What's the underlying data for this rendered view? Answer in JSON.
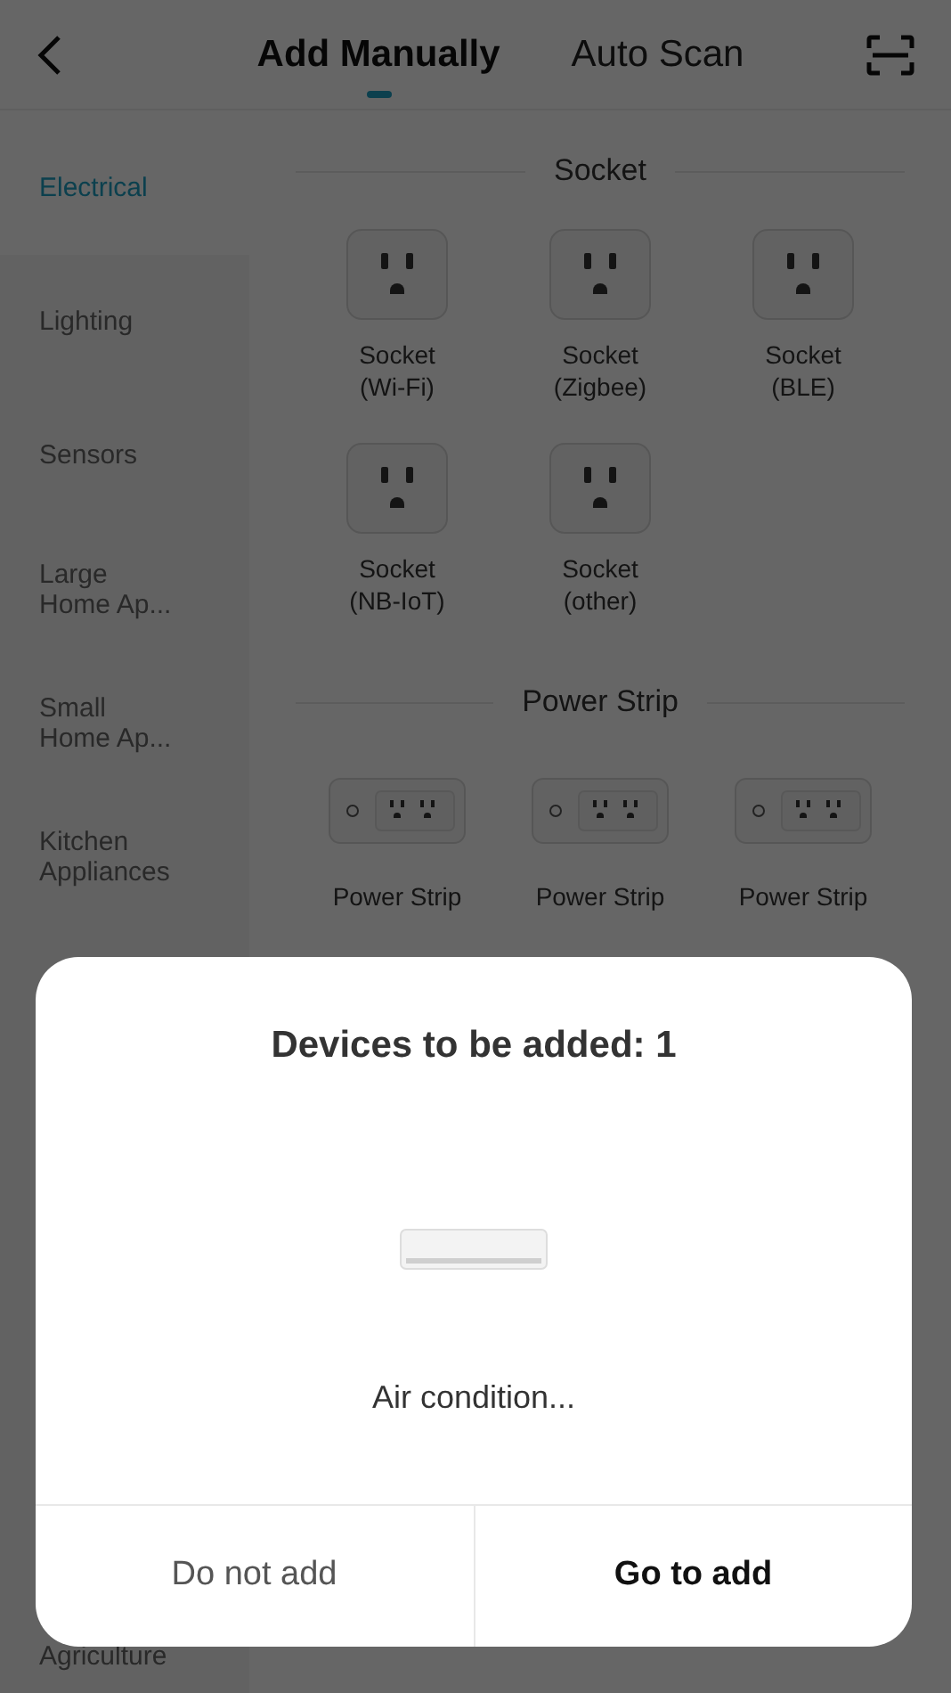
{
  "header": {
    "tabs": [
      {
        "label": "Add Manually",
        "selected": true
      },
      {
        "label": "Auto Scan",
        "selected": false
      }
    ]
  },
  "sidebar": {
    "items": [
      {
        "label": "Electrical",
        "selected": true
      },
      {
        "label": "Lighting",
        "selected": false
      },
      {
        "label": "Sensors",
        "selected": false
      },
      {
        "label": "Large\nHome Ap...",
        "selected": false
      },
      {
        "label": "Small\nHome Ap...",
        "selected": false
      },
      {
        "label": "Kitchen\nAppliances",
        "selected": false
      }
    ],
    "bottom_item": {
      "label": "Agriculture",
      "selected": false
    }
  },
  "sections": [
    {
      "title": "Socket",
      "devices": [
        {
          "kind": "socket",
          "label": "Socket\n(Wi-Fi)"
        },
        {
          "kind": "socket",
          "label": "Socket\n(Zigbee)"
        },
        {
          "kind": "socket",
          "label": "Socket\n(BLE)"
        },
        {
          "kind": "socket",
          "label": "Socket\n(NB-IoT)"
        },
        {
          "kind": "socket",
          "label": "Socket\n(other)"
        }
      ]
    },
    {
      "title": "Power Strip",
      "devices": [
        {
          "kind": "strip",
          "label": "Power Strip"
        },
        {
          "kind": "strip",
          "label": "Power Strip"
        },
        {
          "kind": "strip",
          "label": "Power Strip"
        }
      ]
    }
  ],
  "dialog": {
    "title": "Devices to be added: 1",
    "device": {
      "name": "Air condition..."
    },
    "buttons": [
      {
        "label": "Do not add",
        "primary": false
      },
      {
        "label": "Go to add",
        "primary": true
      }
    ]
  }
}
